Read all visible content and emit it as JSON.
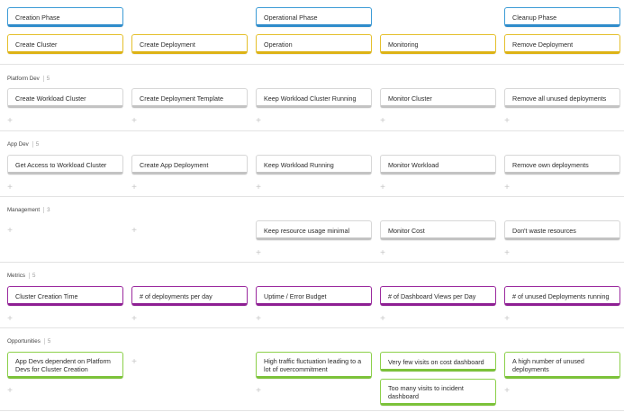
{
  "phases": {
    "creation": "Creation Phase",
    "operational": "Operational Phase",
    "cleanup": "Cleanup Phase"
  },
  "stages": [
    "Create Cluster",
    "Create Deployment",
    "Operation",
    "Monitoring",
    "Remove Deployment"
  ],
  "rows": [
    {
      "label": "Platform Dev",
      "count": "5",
      "cards": [
        "Create Workload Cluster",
        "Create Deployment Template",
        "Keep Workload Cluster Running",
        "Monitor Cluster",
        "Remove all unused deployments"
      ]
    },
    {
      "label": "App Dev",
      "count": "5",
      "cards": [
        "Get Access to Workload Cluster",
        "Create App Deployment",
        "Keep Workload Running",
        "Monitor Workload",
        "Remove own deployments"
      ]
    },
    {
      "label": "Management",
      "count": "3",
      "cards": [
        "Keep resource usage minimal",
        "Monitor Cost",
        "Don't waste resources"
      ]
    },
    {
      "label": "Metrics",
      "count": "5",
      "cards": [
        "Cluster Creation Time",
        "# of deployments per day",
        "Uptime / Error Budget",
        "# of Dashboard Views per Day",
        "# of unused Deployments running"
      ]
    },
    {
      "label": "Opportunities",
      "count": "5",
      "cards": [
        "App Devs dependent on Platform Devs for Cluster Creation",
        "High traffic fluctuation leading to a lot of overcommitment",
        "Very few visits on cost dashboard",
        "Too many visits to incident dashboard",
        "A high number of unused deployments"
      ]
    }
  ],
  "add_symbol": "+",
  "colors": {
    "phase": "#3d9cd6",
    "stage": "#e5c02c",
    "default": "#d7d7d7",
    "metrics": "#9b2a9f",
    "opportunities": "#8cd04a"
  }
}
